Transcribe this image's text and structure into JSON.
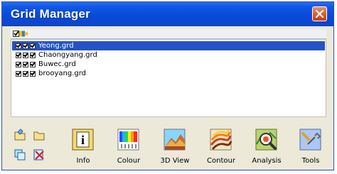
{
  "window": {
    "title": "Grid Manager"
  },
  "grids": [
    {
      "name": "Yeong.grd",
      "selected": true
    },
    {
      "name": "Chaongyang.grd",
      "selected": false
    },
    {
      "name": "Buwec.grd",
      "selected": false
    },
    {
      "name": "brooyang.grd",
      "selected": false
    }
  ],
  "tools": [
    {
      "label": "Info",
      "icon": "info-icon"
    },
    {
      "label": "Colour",
      "icon": "colour-icon"
    },
    {
      "label": "3D View",
      "icon": "3d-view-icon"
    },
    {
      "label": "Contour",
      "icon": "contour-icon"
    },
    {
      "label": "Analysis",
      "icon": "analysis-icon"
    },
    {
      "label": "Tools",
      "icon": "tools-icon"
    }
  ],
  "colors": {
    "title_bar": "#0b4fd9",
    "selection": "#2453c7",
    "window_face": "#ece9d8"
  }
}
